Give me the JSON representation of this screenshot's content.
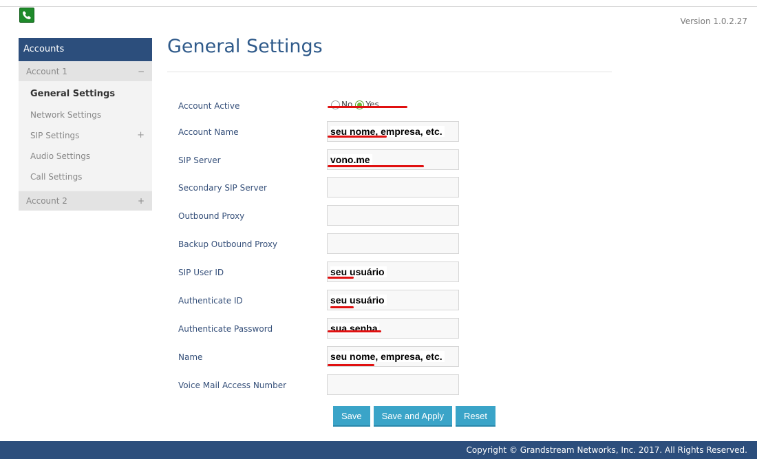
{
  "header": {
    "logo_icon": "phone-logo-icon",
    "version": "Version 1.0.2.27"
  },
  "sidebar": {
    "heading": "Accounts",
    "account1": {
      "label": "Account 1",
      "toggle": "−",
      "items": [
        {
          "label": "General Settings",
          "active": true
        },
        {
          "label": "Network Settings"
        },
        {
          "label": "SIP Settings",
          "toggle": "+"
        },
        {
          "label": "Audio Settings"
        },
        {
          "label": "Call Settings"
        }
      ]
    },
    "account2": {
      "label": "Account 2",
      "toggle": "+"
    }
  },
  "main": {
    "title": "General Settings",
    "account_active": {
      "label": "Account Active",
      "options": [
        "No",
        "Yes"
      ],
      "selected": "Yes"
    },
    "fields": [
      {
        "label": "Account Name",
        "value": "seu nome, empresa, etc."
      },
      {
        "label": "SIP Server",
        "value": "vono.me"
      },
      {
        "label": "Secondary SIP Server",
        "value": ""
      },
      {
        "label": "Outbound Proxy",
        "value": ""
      },
      {
        "label": "Backup Outbound Proxy",
        "value": ""
      },
      {
        "label": "SIP User ID",
        "value": "seu usuário"
      },
      {
        "label": "Authenticate ID",
        "value": "seu usuário"
      },
      {
        "label": "Authenticate Password",
        "value": "sua senha"
      },
      {
        "label": "Name",
        "value": "seu nome, empresa, etc."
      },
      {
        "label": "Voice Mail Access Number",
        "value": ""
      }
    ],
    "buttons": {
      "save": "Save",
      "save_apply": "Save and Apply",
      "reset": "Reset"
    }
  },
  "footer": {
    "copyright": "Copyright © Grandstream Networks, Inc. 2017. All Rights Reserved."
  },
  "colors": {
    "header_blue": "#2c4e7c",
    "button_blue": "#3aa4c8",
    "annotation_red": "#e01010",
    "title_blue": "#2f5a8a"
  }
}
